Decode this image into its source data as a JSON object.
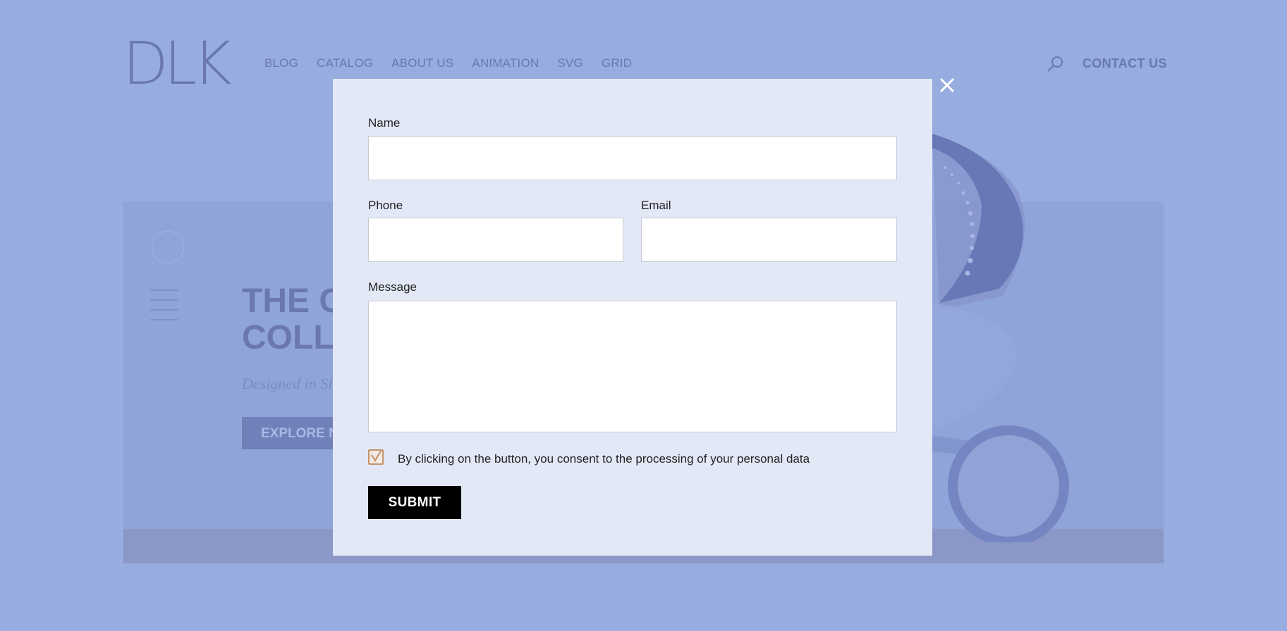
{
  "site": {
    "logo": "DLK",
    "nav": [
      "BLOG",
      "CATALOG",
      "ABOUT US",
      "ANIMATION",
      "SVG",
      "GRID"
    ],
    "contact_label": "CONTACT US",
    "hero": {
      "title_line1": "THE C",
      "title_line2": "COLL",
      "subtitle": "Designed in Sl",
      "button_label": "EXPLORE N"
    }
  },
  "modal": {
    "close_icon": "close-icon",
    "fields": {
      "name_label": "Name",
      "phone_label": "Phone",
      "email_label": "Email",
      "message_label": "Message",
      "name_value": "",
      "phone_value": "",
      "email_value": "",
      "message_value": ""
    },
    "consent_text": "By clicking on the button, you consent to the processing of your personal data",
    "consent_checked": true,
    "submit_label": "SUBMIT"
  },
  "colors": {
    "overlay": "#97acdf",
    "modal_bg": "#e3e8f7",
    "checkbox_accent": "#c4956a",
    "submit_bg": "#000000"
  }
}
